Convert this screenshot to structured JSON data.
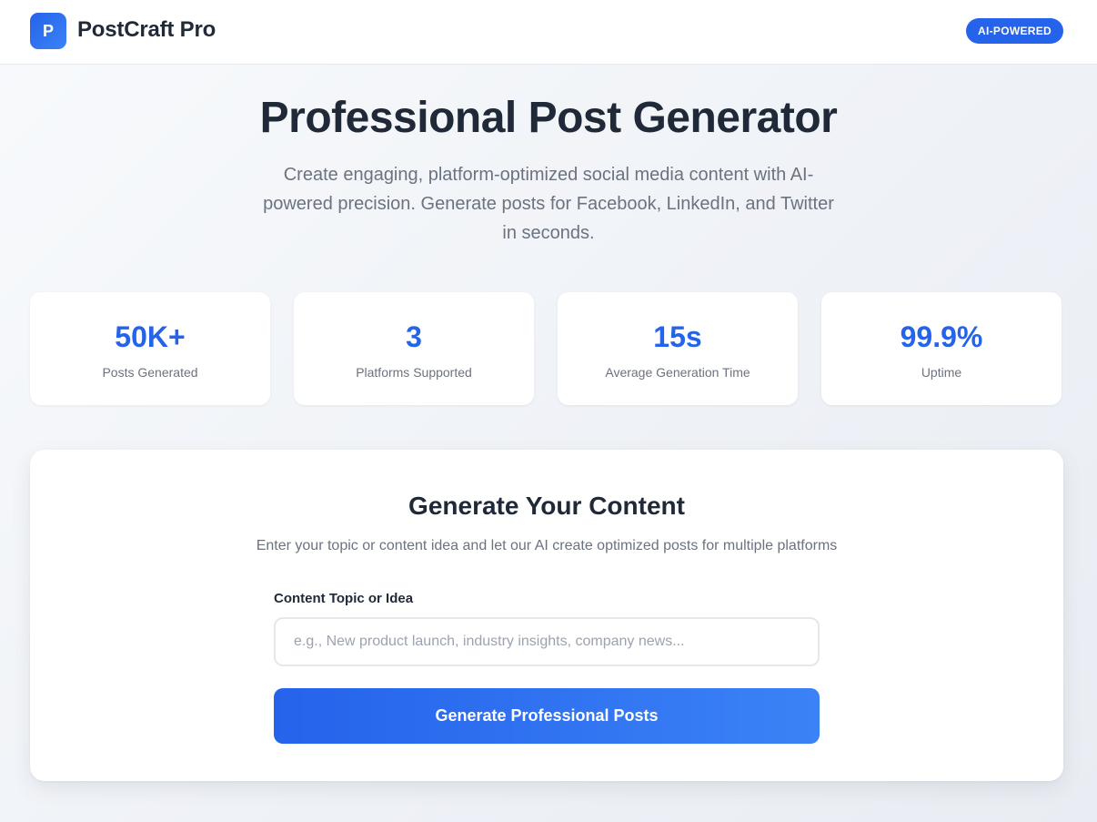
{
  "header": {
    "logo_letter": "P",
    "brand_name": "PostCraft Pro",
    "badge": "AI-POWERED"
  },
  "hero": {
    "title": "Professional Post Generator",
    "subtitle": "Create engaging, platform-optimized social media content with AI-powered precision. Generate posts for Facebook, LinkedIn, and Twitter in seconds."
  },
  "stats": [
    {
      "value": "50K+",
      "label": "Posts Generated"
    },
    {
      "value": "3",
      "label": "Platforms Supported"
    },
    {
      "value": "15s",
      "label": "Average Generation Time"
    },
    {
      "value": "99.9%",
      "label": "Uptime"
    }
  ],
  "generator": {
    "title": "Generate Your Content",
    "subtitle": "Enter your topic or content idea and let our AI create optimized posts for multiple platforms",
    "field_label": "Content Topic or Idea",
    "input_value": "",
    "input_placeholder": "e.g., New product launch, industry insights, company news...",
    "button_label": "Generate Professional Posts"
  },
  "colors": {
    "accent": "#2563eb",
    "accent_light": "#3b82f6",
    "text_primary": "#1f2937",
    "text_muted": "#6b7280"
  }
}
